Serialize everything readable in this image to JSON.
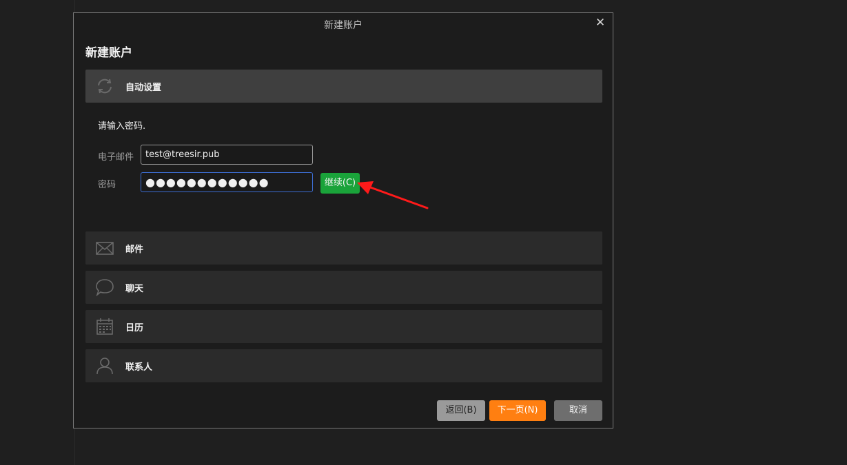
{
  "dialog": {
    "window_title": "新建账户",
    "heading": "新建账户",
    "close_glyph": "✕"
  },
  "auto_setup": {
    "label": "自动设置",
    "icon": "sync-icon",
    "prompt": "请输入密码.",
    "email_label": "电子邮件",
    "email_value": "test@treesir.pub",
    "password_label": "密码",
    "password_masked": "●●●●●●●●●●●●",
    "continue_label": "继续(C)"
  },
  "sections": [
    {
      "label": "邮件",
      "icon": "mail-icon"
    },
    {
      "label": "聊天",
      "icon": "chat-icon"
    },
    {
      "label": "日历",
      "icon": "calendar-icon"
    },
    {
      "label": "联系人",
      "icon": "contact-icon"
    }
  ],
  "footer": {
    "back_label": "返回(B)",
    "next_label": "下一页(N)",
    "cancel_label": "取消"
  },
  "colors": {
    "continue": "#1aa33a",
    "next": "#ff7f11",
    "annotation_arrow": "#ff1a1a",
    "focus_border": "#3d6fd6"
  }
}
